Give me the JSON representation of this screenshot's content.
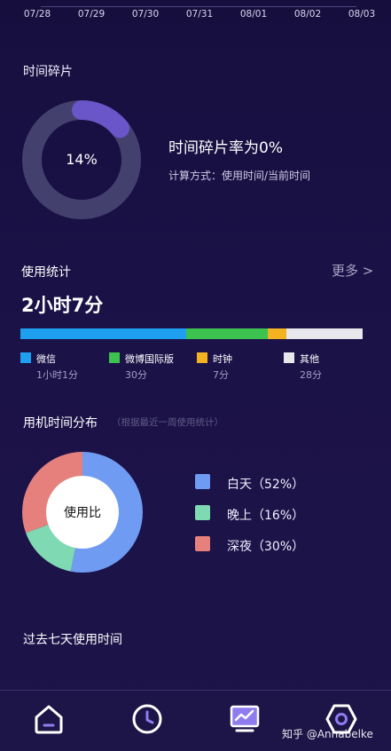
{
  "header": {
    "dates": [
      "07/28",
      "07/29",
      "07/30",
      "07/31",
      "08/01",
      "08/02",
      "08/03"
    ]
  },
  "fragment": {
    "title": "时间碎片",
    "percent_label": "14%",
    "percent": 14,
    "rate_text": "时间碎片率为0%",
    "method_text": "计算方式：使用时间/当前时间",
    "colors": {
      "fill": "#6a55c9",
      "track": "#44406e"
    }
  },
  "usage": {
    "title": "使用统计",
    "more_label": "更多 >",
    "total": "2小时7分",
    "apps": [
      {
        "name": "微信",
        "time": "1小时1分",
        "minutes": 61,
        "color": "#1e9ff0"
      },
      {
        "name": "微博国际版",
        "time": "30分",
        "minutes": 30,
        "color": "#3cc24e"
      },
      {
        "name": "时钟",
        "time": "7分",
        "minutes": 7,
        "color": "#f3b321"
      },
      {
        "name": "其他",
        "time": "28分",
        "minutes": 28,
        "color": "#e7e7ec"
      }
    ]
  },
  "distribution": {
    "title": "用机时间分布",
    "note": "（根据最近一周使用统计）",
    "center_label": "使用比",
    "segments": [
      {
        "label": "白天（52%）",
        "percent": 52,
        "color": "#6f9bf3"
      },
      {
        "label": "晚上（16%）",
        "percent": 16,
        "color": "#7fd9b3"
      },
      {
        "label": "深夜（30%）",
        "percent": 30,
        "color": "#e6807c"
      }
    ]
  },
  "past": {
    "title": "过去七天使用时间"
  },
  "nav": {
    "items": [
      {
        "icon": "home-icon"
      },
      {
        "icon": "clock-icon"
      },
      {
        "icon": "chart-monitor-icon"
      },
      {
        "icon": "settings-hexagon-icon"
      }
    ]
  },
  "watermark": "知乎 @Annabelke"
}
